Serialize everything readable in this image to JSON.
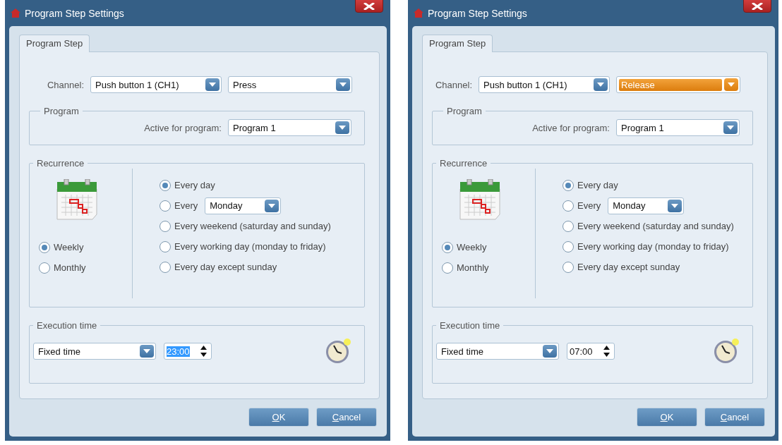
{
  "dialogs": [
    {
      "title": "Program Step Settings",
      "tabs": [
        {
          "label": "Program Step",
          "selected": true
        }
      ],
      "channel": {
        "label": "Channel:",
        "value": "Push button 1 (CH1)",
        "action": {
          "value": "Press",
          "focused": false
        }
      },
      "program": {
        "legend": "Program",
        "label": "Active for program:",
        "value": "Program 1"
      },
      "recurrence": {
        "legend": "Recurrence",
        "modes": [
          {
            "label": "Weekly",
            "selected": true
          },
          {
            "label": "Monthly",
            "selected": false
          }
        ],
        "options": [
          {
            "kind": "plain",
            "label": "Every day",
            "selected": true
          },
          {
            "kind": "weekday",
            "label": "Every",
            "day": "Monday",
            "selected": false
          },
          {
            "kind": "plain",
            "label": "Every weekend (saturday and sunday)",
            "selected": false
          },
          {
            "kind": "plain",
            "label": "Every working day (monday to friday)",
            "selected": false
          },
          {
            "kind": "plain",
            "label": "Every day except sunday",
            "selected": false
          }
        ]
      },
      "execution": {
        "legend": "Execution time",
        "mode": "Fixed time",
        "time": {
          "value": "23:00",
          "selected": true
        }
      },
      "buttons": [
        {
          "label": "OK"
        },
        {
          "label": "Cancel"
        }
      ]
    },
    {
      "title": "Program Step Settings",
      "tabs": [
        {
          "label": "Program Step",
          "selected": true
        }
      ],
      "channel": {
        "label": "Channel:",
        "value": "Push button 1 (CH1)",
        "action": {
          "value": "Release",
          "focused": true
        }
      },
      "program": {
        "legend": "Program",
        "label": "Active for program:",
        "value": "Program 1"
      },
      "recurrence": {
        "legend": "Recurrence",
        "modes": [
          {
            "label": "Weekly",
            "selected": true
          },
          {
            "label": "Monthly",
            "selected": false
          }
        ],
        "options": [
          {
            "kind": "plain",
            "label": "Every day",
            "selected": true
          },
          {
            "kind": "weekday",
            "label": "Every",
            "day": "Monday",
            "selected": false
          },
          {
            "kind": "plain",
            "label": "Every weekend (saturday and sunday)",
            "selected": false
          },
          {
            "kind": "plain",
            "label": "Every working day (monday to friday)",
            "selected": false
          },
          {
            "kind": "plain",
            "label": "Every day except sunday",
            "selected": false
          }
        ]
      },
      "execution": {
        "legend": "Execution time",
        "mode": "Fixed time",
        "time": {
          "value": "07:00",
          "selected": false
        }
      },
      "buttons": [
        {
          "label": "OK"
        },
        {
          "label": "Cancel"
        }
      ]
    }
  ]
}
